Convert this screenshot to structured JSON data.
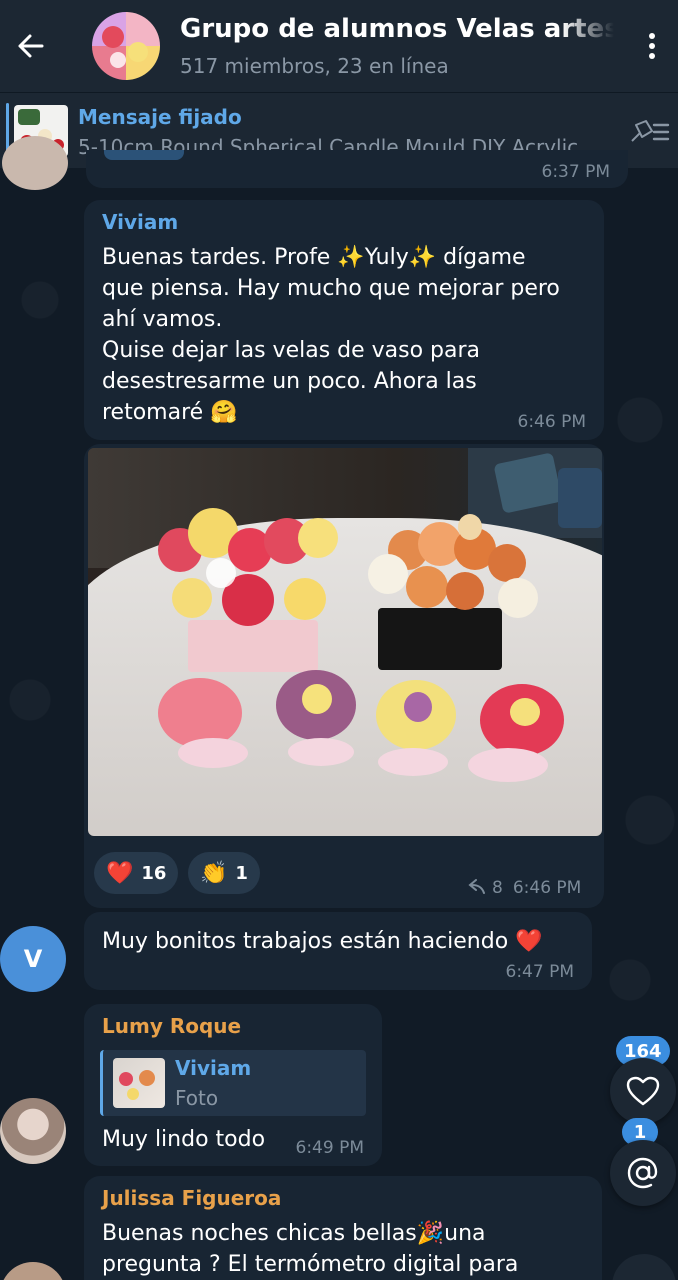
{
  "header": {
    "title": "Grupo de alumnos Velas artesanales",
    "subtitle": "517 miembros, 23 en línea"
  },
  "pinned": {
    "label": "Mensaje fijado",
    "text": "5-10cm Round Spherical Candle Mould DIY Acrylic..."
  },
  "prev_time": "6:37 PM",
  "messages": [
    {
      "sender": "Viviam",
      "sender_color": "#5fa8e8",
      "lines": [
        "Buenas tardes. Profe ✨Yuly✨ dígame",
        "que piensa. Hay mucho que mejorar pero",
        "ahí vamos.",
        "Quise dejar las velas de vaso para",
        "desestresarme un poco.  Ahora las",
        "retomaré 🤗"
      ],
      "time": "6:46 PM"
    },
    {
      "photo_caption_time": "6:46 PM",
      "replies": "8",
      "reactions": [
        {
          "emoji": "❤️",
          "count": "16"
        },
        {
          "emoji": "👏",
          "count": "1"
        }
      ]
    },
    {
      "avatar_letter": "V",
      "text": "Muy bonitos trabajos están haciendo ❤️",
      "time": "6:47 PM"
    },
    {
      "sender": "Lumy Roque",
      "sender_color": "#e8a14a",
      "reply_to": {
        "sender": "Viviam",
        "text": "Foto"
      },
      "text": "Muy lindo todo",
      "time": "6:49 PM"
    },
    {
      "sender": "Julissa Figueroa",
      "sender_color": "#e8a14a",
      "lines": [
        "Buenas noches chicas bellas🎉una",
        "pregunta ? El termómetro digital para"
      ]
    }
  ],
  "floating": {
    "reactions_badge": "164",
    "mentions_badge": "1"
  },
  "icons": {
    "back": "arrow-left-icon",
    "menu": "more-vertical-icon",
    "pin_list": "pin-list-icon",
    "reply": "reply-icon",
    "heart": "heart-icon",
    "mention": "at-icon"
  },
  "colors": {
    "accent": "#5fa8e8",
    "bubble": "#182533",
    "header": "#1c2733",
    "badge": "#3b8ee0"
  }
}
